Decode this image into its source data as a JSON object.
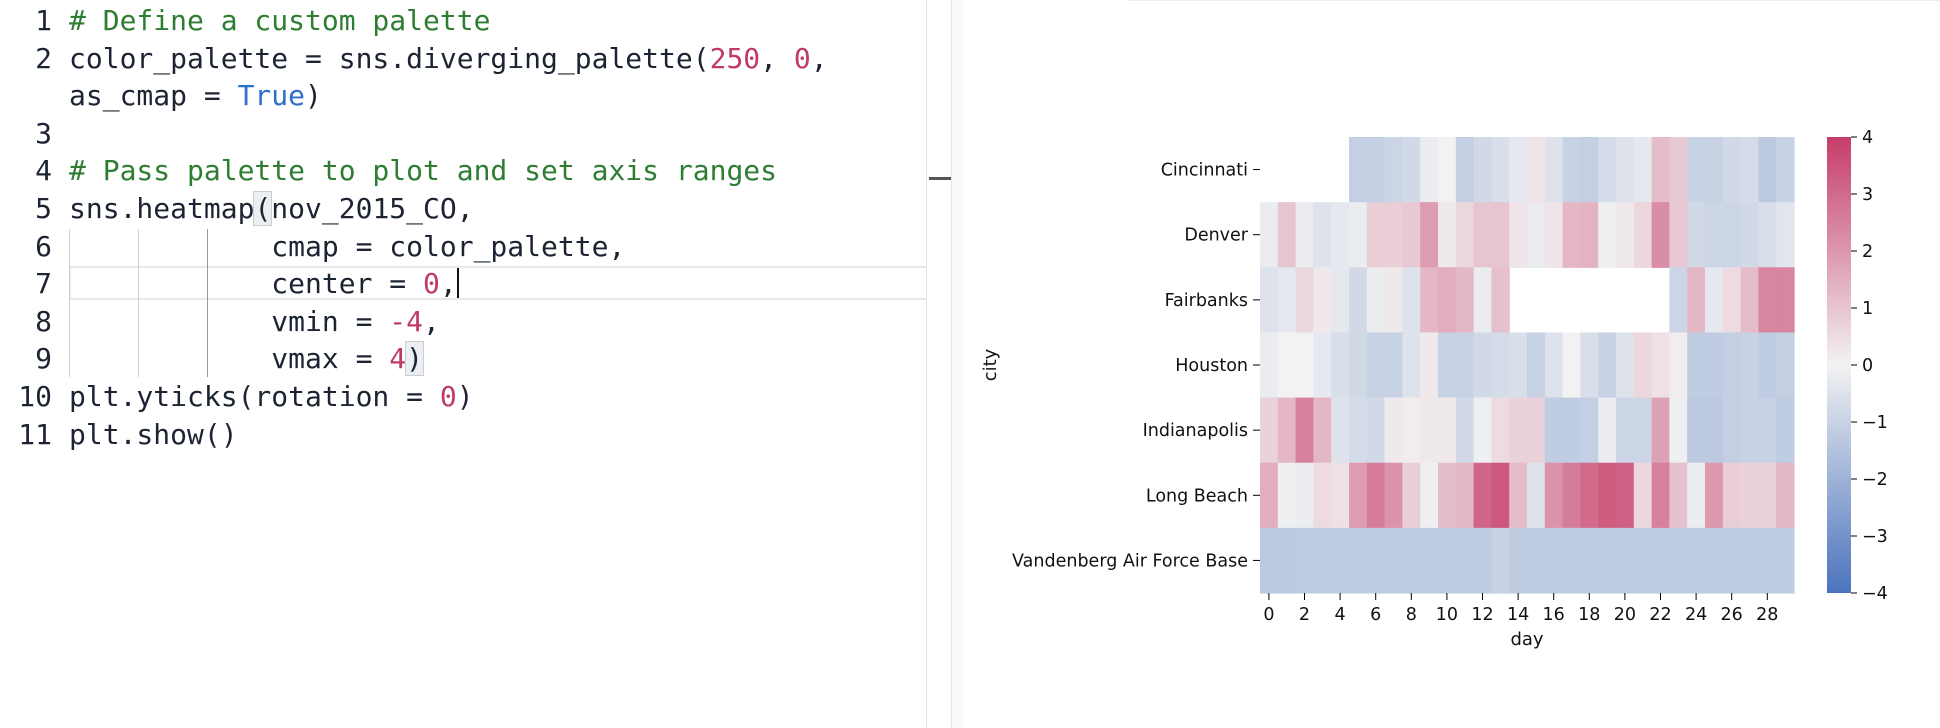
{
  "editor": {
    "lines": [
      {
        "n": "1",
        "tokens": [
          {
            "t": "# Define a custom palette",
            "c": "cmt"
          }
        ]
      },
      {
        "n": "2",
        "tokens": [
          {
            "t": "color_palette = sns.diverging_palette(",
            "c": ""
          },
          {
            "t": "250",
            "c": "num"
          },
          {
            "t": ", ",
            "c": ""
          },
          {
            "t": "0",
            "c": "num"
          },
          {
            "t": ",",
            "c": ""
          }
        ]
      },
      {
        "n": "",
        "tokens": [
          {
            "t": "as_cmap = ",
            "c": ""
          },
          {
            "t": "True",
            "c": "kw"
          },
          {
            "t": ")",
            "c": ""
          }
        ]
      },
      {
        "n": "3",
        "tokens": []
      },
      {
        "n": "4",
        "tokens": [
          {
            "t": "# Pass palette to plot and set axis ranges",
            "c": "cmt"
          }
        ]
      },
      {
        "n": "5",
        "tokens": [
          {
            "t": "sns.heatmap",
            "c": ""
          },
          {
            "t": "(",
            "c": "hl"
          },
          {
            "t": "nov_2015_CO,",
            "c": ""
          }
        ]
      },
      {
        "n": "6",
        "tokens": [
          {
            "t": "            cmap = color_palette,",
            "c": ""
          }
        ]
      },
      {
        "n": "7",
        "tokens": [
          {
            "t": "            center = ",
            "c": ""
          },
          {
            "t": "0",
            "c": "num"
          },
          {
            "t": ",",
            "c": ""
          },
          {
            "t": "",
            "c": "cursor"
          }
        ]
      },
      {
        "n": "8",
        "tokens": [
          {
            "t": "            vmin = ",
            "c": ""
          },
          {
            "t": "-4",
            "c": "num"
          },
          {
            "t": ",",
            "c": ""
          }
        ]
      },
      {
        "n": "9",
        "tokens": [
          {
            "t": "            vmax = ",
            "c": ""
          },
          {
            "t": "4",
            "c": "num"
          },
          {
            "t": ")",
            "c": "hl"
          }
        ]
      },
      {
        "n": "10",
        "tokens": [
          {
            "t": "plt.yticks(rotation = ",
            "c": ""
          },
          {
            "t": "0",
            "c": "num"
          },
          {
            "t": ")",
            "c": ""
          }
        ]
      },
      {
        "n": "11",
        "tokens": [
          {
            "t": "plt.show()",
            "c": ""
          }
        ]
      }
    ]
  },
  "chart_data": {
    "type": "heatmap",
    "title": "",
    "xlabel": "day",
    "ylabel": "city",
    "x": [
      0,
      1,
      2,
      3,
      4,
      5,
      6,
      7,
      8,
      9,
      10,
      11,
      12,
      13,
      14,
      15,
      16,
      17,
      18,
      19,
      20,
      21,
      22,
      23,
      24,
      25,
      26,
      27,
      28,
      29
    ],
    "x_tick_labels": [
      "0",
      "2",
      "4",
      "6",
      "8",
      "10",
      "12",
      "14",
      "16",
      "18",
      "20",
      "22",
      "24",
      "26",
      "28"
    ],
    "y": [
      "Cincinnati",
      "Denver",
      "Fairbanks",
      "Houston",
      "Indianapolis",
      "Long Beach",
      "Vandenberg Air Force Base"
    ],
    "vmin": -4,
    "vmax": 4,
    "center": 0,
    "colorbar_ticks": [
      "4",
      "3",
      "2",
      "1",
      "0",
      "−1",
      "−2",
      "−3",
      "−4"
    ],
    "colors": {
      "low": "#4b73bd",
      "mid": "#f2f2f2",
      "high": "#c63d68"
    },
    "values": [
      [
        null,
        null,
        null,
        null,
        null,
        -1.1,
        -1.1,
        -0.9,
        -0.8,
        -0.2,
        0.0,
        -1.1,
        -0.8,
        -0.6,
        -0.3,
        0.3,
        -0.5,
        -1.0,
        -1.1,
        -0.7,
        -0.5,
        -0.3,
        1.2,
        0.9,
        -1.0,
        -1.0,
        -0.8,
        -0.7,
        -1.3,
        -1.0
      ],
      [
        -0.2,
        1.0,
        -0.2,
        -0.5,
        -0.3,
        -0.2,
        0.8,
        0.8,
        0.9,
        1.9,
        0.2,
        0.6,
        1.0,
        1.0,
        0.3,
        -0.2,
        0.3,
        1.3,
        1.4,
        -0.1,
        0.2,
        0.6,
        2.2,
        0.9,
        -0.8,
        -0.9,
        -0.9,
        -0.8,
        -0.6,
        -0.4
      ],
      [
        -0.5,
        -0.3,
        0.6,
        0.2,
        -0.3,
        -0.8,
        -0.2,
        0.2,
        -0.5,
        1.3,
        1.5,
        1.3,
        -0.2,
        1.1,
        null,
        null,
        null,
        null,
        null,
        null,
        null,
        null,
        null,
        -0.9,
        1.3,
        -0.3,
        0.5,
        1.2,
        2.4,
        2.4
      ],
      [
        -0.2,
        0.0,
        0.0,
        -0.3,
        -0.6,
        -0.8,
        -1.0,
        -1.0,
        -0.5,
        0.2,
        -1.0,
        -1.0,
        -0.8,
        -0.7,
        -0.6,
        -1.0,
        -0.5,
        0.0,
        -0.6,
        -1.0,
        -0.5,
        0.6,
        0.4,
        0.1,
        -1.2,
        -1.2,
        -1.1,
        -1.0,
        -1.2,
        -1.1
      ],
      [
        0.7,
        1.3,
        2.5,
        1.3,
        -0.5,
        -0.7,
        -0.8,
        0.2,
        0.1,
        0.2,
        0.2,
        -0.8,
        -0.1,
        0.5,
        0.7,
        0.7,
        -1.2,
        -1.2,
        -1.1,
        -0.2,
        -0.9,
        -0.9,
        1.8,
        -0.1,
        -1.3,
        -1.3,
        -1.1,
        -1.0,
        -1.0,
        -1.2
      ],
      [
        1.5,
        -0.1,
        -0.2,
        0.5,
        0.4,
        1.9,
        2.6,
        2.1,
        0.8,
        -0.1,
        1.2,
        1.3,
        3.1,
        3.4,
        1.2,
        -0.5,
        2.1,
        2.6,
        3.0,
        3.3,
        3.2,
        0.6,
        2.5,
        1.1,
        -0.2,
        2.0,
        0.8,
        0.7,
        0.7,
        1.3
      ],
      [
        -1.3,
        -1.3,
        -1.2,
        -1.2,
        -1.2,
        -1.2,
        -1.2,
        -1.2,
        -1.2,
        -1.2,
        -1.2,
        -1.2,
        -1.2,
        -1.0,
        -1.2,
        -1.2,
        -1.2,
        -1.2,
        -1.2,
        -1.2,
        -1.2,
        -1.2,
        -1.2,
        -1.2,
        -1.2,
        -1.2,
        -1.2,
        -1.2,
        -1.2,
        -1.2
      ]
    ]
  }
}
